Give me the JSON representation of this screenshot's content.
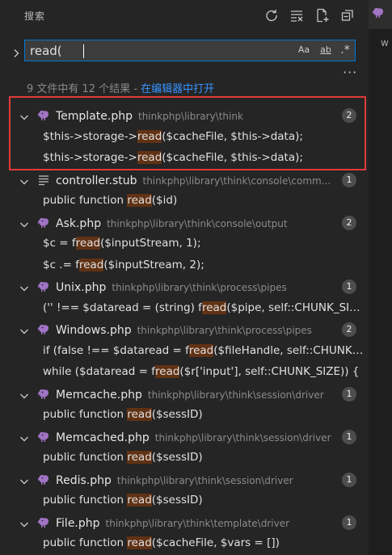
{
  "header": {
    "title": "搜索"
  },
  "search": {
    "value": "read(",
    "opt_case": "Aa",
    "opt_word": "ab",
    "opt_regex": ".*"
  },
  "summary": {
    "text": "9 文件中有 12 个结果 - ",
    "link": "在编辑器中打开"
  },
  "right_panel": {
    "partial_text": "w"
  },
  "files": [
    {
      "name": "Template.php",
      "path": "thinkphp\\library\\think",
      "count": "2",
      "icon": "php-elephant-icon",
      "matches": [
        {
          "pre": "$this->storage->",
          "hit": "read",
          "post": "($cacheFile, $this->data);"
        },
        {
          "pre": "$this->storage->",
          "hit": "read",
          "post": "($cacheFile, $this->data);"
        }
      ]
    },
    {
      "name": "controller.stub",
      "path": "thinkphp\\library\\think\\console\\comm...",
      "count": "1",
      "icon": "lines-file-icon",
      "matches": [
        {
          "pre": "public function ",
          "hit": "read",
          "post": "($id)"
        }
      ]
    },
    {
      "name": "Ask.php",
      "path": "thinkphp\\library\\think\\console\\output",
      "count": "2",
      "icon": "php-elephant-icon",
      "matches": [
        {
          "pre": "$c = f",
          "hit": "read",
          "post": "($inputStream, 1);"
        },
        {
          "pre": "$c .= f",
          "hit": "read",
          "post": "($inputStream, 2);"
        }
      ]
    },
    {
      "name": "Unix.php",
      "path": "thinkphp\\library\\think\\process\\pipes",
      "count": "1",
      "icon": "php-elephant-icon",
      "matches": [
        {
          "pre": "('' !== $dataread = (string) f",
          "hit": "read",
          "post": "($pipe, self::CHUNK_SIZE..."
        }
      ]
    },
    {
      "name": "Windows.php",
      "path": "thinkphp\\library\\think\\process\\pipes",
      "count": "2",
      "icon": "php-elephant-icon",
      "matches": [
        {
          "pre": "if (false !== $dataread = f",
          "hit": "read",
          "post": "($fileHandle, self::CHUNK_..."
        },
        {
          "pre": "while ($dataread = f",
          "hit": "read",
          "post": "($r['input'], self::CHUNK_SIZE)) {"
        }
      ]
    },
    {
      "name": "Memcache.php",
      "path": "thinkphp\\library\\think\\session\\driver",
      "count": "1",
      "icon": "php-elephant-icon",
      "matches": [
        {
          "pre": "public function ",
          "hit": "read",
          "post": "($sessID)"
        }
      ]
    },
    {
      "name": "Memcached.php",
      "path": "thinkphp\\library\\think\\session\\driver",
      "count": "1",
      "icon": "php-elephant-icon",
      "matches": [
        {
          "pre": "public function ",
          "hit": "read",
          "post": "($sessID)"
        }
      ]
    },
    {
      "name": "Redis.php",
      "path": "thinkphp\\library\\think\\session\\driver",
      "count": "1",
      "icon": "php-elephant-icon",
      "matches": [
        {
          "pre": "public function ",
          "hit": "read",
          "post": "($sessID)"
        }
      ]
    },
    {
      "name": "File.php",
      "path": "thinkphp\\library\\think\\template\\driver",
      "count": "1",
      "icon": "php-elephant-icon",
      "matches": [
        {
          "pre": "public function ",
          "hit": "read",
          "post": "($cacheFile, $vars = [])"
        }
      ]
    }
  ],
  "colors": {
    "accent": "#0078d4",
    "link": "#3794ff",
    "match_highlight": "#613214",
    "annotation_box": "#e03a3a",
    "php_icon": "#a074c4"
  }
}
